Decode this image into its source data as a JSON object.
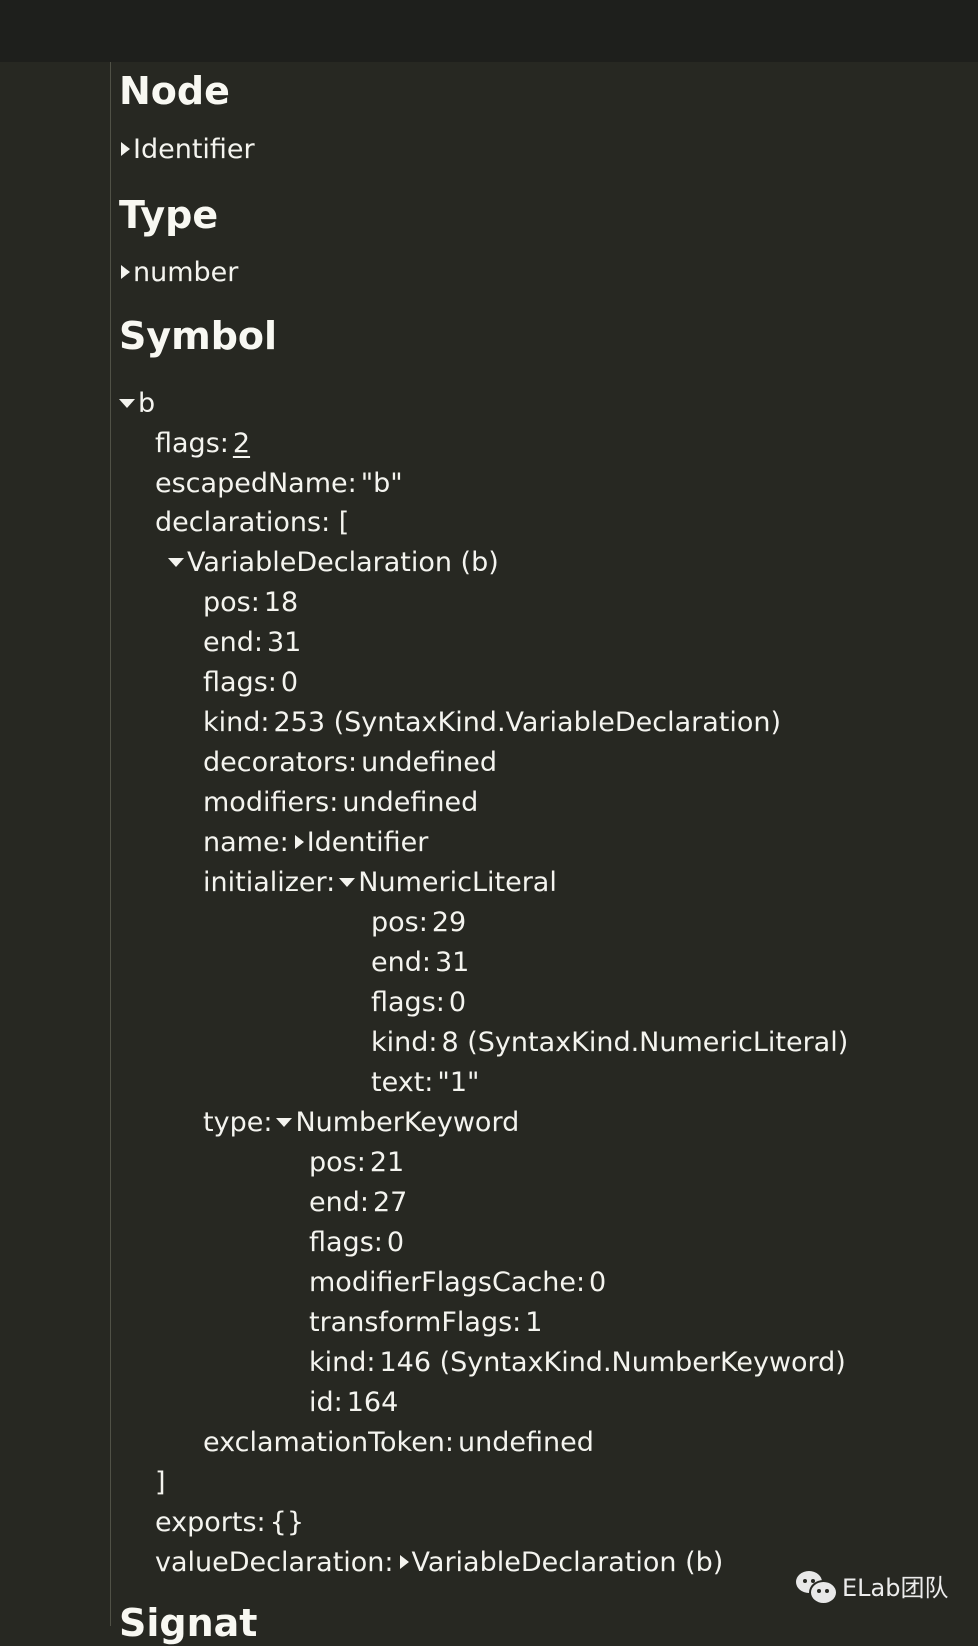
{
  "headings": {
    "node": "Node",
    "type": "Type",
    "symbol": "Symbol",
    "signature_partial": "Signat"
  },
  "node": {
    "value": "Identifier"
  },
  "type": {
    "value": "number"
  },
  "symbol": {
    "name": "b",
    "flags": {
      "key": "flags",
      "value": "2"
    },
    "escapedName": {
      "key": "escapedName",
      "value": "\"b\""
    },
    "declarations_open": "declarations: [",
    "declaration": {
      "label": "VariableDeclaration (b)",
      "pos": {
        "key": "pos",
        "value": "18"
      },
      "end": {
        "key": "end",
        "value": "31"
      },
      "flags": {
        "key": "flags",
        "value": "0"
      },
      "kind": {
        "key": "kind",
        "value": "253 (SyntaxKind.VariableDeclaration)"
      },
      "decorators": {
        "key": "decorators",
        "value": "undefined"
      },
      "modifiers": {
        "key": "modifiers",
        "value": "undefined"
      },
      "name": {
        "key": "name",
        "value": "Identifier"
      },
      "initializer": {
        "key": "initializer",
        "label": "NumericLiteral",
        "pos": {
          "key": "pos",
          "value": "29"
        },
        "end": {
          "key": "end",
          "value": "31"
        },
        "flags": {
          "key": "flags",
          "value": "0"
        },
        "kind": {
          "key": "kind",
          "value": "8 (SyntaxKind.NumericLiteral)"
        },
        "text": {
          "key": "text",
          "value": "\"1\""
        }
      },
      "type": {
        "key": "type",
        "label": "NumberKeyword",
        "pos": {
          "key": "pos",
          "value": "21"
        },
        "end": {
          "key": "end",
          "value": "27"
        },
        "flags": {
          "key": "flags",
          "value": "0"
        },
        "modifierFlagsCache": {
          "key": "modifierFlagsCache",
          "value": "0"
        },
        "transformFlags": {
          "key": "transformFlags",
          "value": "1"
        },
        "kind": {
          "key": "kind",
          "value": "146 (SyntaxKind.NumberKeyword)"
        },
        "id": {
          "key": "id",
          "value": "164"
        }
      },
      "exclamationToken": {
        "key": "exclamationToken",
        "value": "undefined"
      }
    },
    "declarations_close": "]",
    "exports": {
      "key": "exports",
      "value": "{}"
    },
    "valueDeclaration": {
      "key": "valueDeclaration",
      "value": "VariableDeclaration (b)"
    }
  },
  "watermark": {
    "text": "ELab团队",
    "icon": "wechat-icon"
  }
}
